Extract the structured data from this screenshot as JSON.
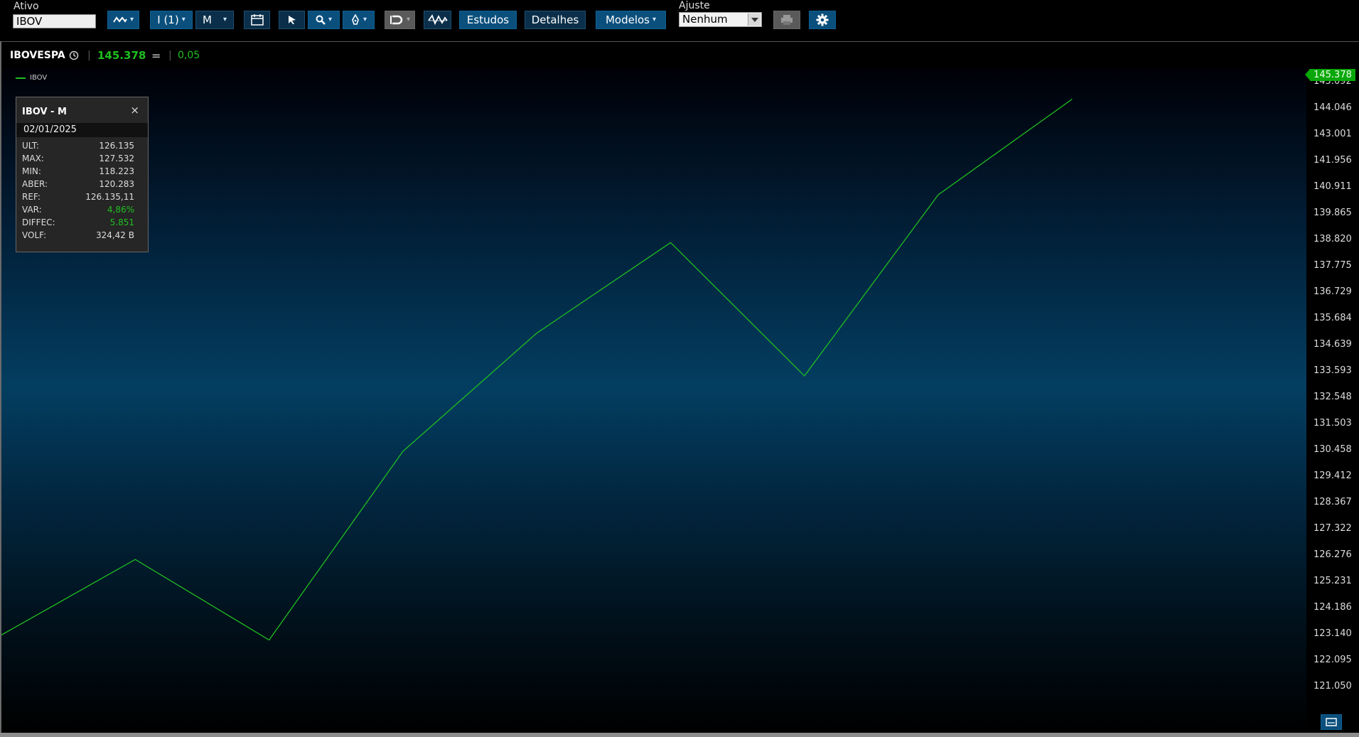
{
  "toolbar": {
    "asset_label": "Ativo",
    "asset_value": "IBOV",
    "interval_label": "I (1)",
    "period_label": "M",
    "studies_label": "Estudos",
    "details_label": "Detalhes",
    "templates_label": "Modelos",
    "adjust_label": "Ajuste",
    "adjust_value": "Nenhum"
  },
  "quote": {
    "symbol": "IBOVESPA",
    "last": "145.378",
    "direction": "=",
    "change": "0,05"
  },
  "legend": {
    "series": "IBOV"
  },
  "info_box": {
    "title": "IBOV - M",
    "close": "×",
    "date": "02/01/2025",
    "rows": [
      {
        "label": "ULT:",
        "value": "126.135"
      },
      {
        "label": "MAX:",
        "value": "127.532"
      },
      {
        "label": "MIN:",
        "value": "118.223"
      },
      {
        "label": "ABER:",
        "value": "120.283"
      },
      {
        "label": "REF:",
        "value": "126.135,11"
      },
      {
        "label": "VAR:",
        "value": "4,86%"
      },
      {
        "label": "DIFFEC:",
        "value": "5.851"
      },
      {
        "label": "VOLF:",
        "value": "324,42 B"
      }
    ]
  },
  "price_tag": "145.378",
  "colors": {
    "line": "#1fbf1f",
    "accent": "#0b4f7c"
  },
  "chart_data": {
    "type": "line",
    "series": [
      {
        "name": "IBOV",
        "values": [
          123.1,
          126.1,
          122.9,
          130.4,
          135.1,
          138.7,
          133.4,
          140.6,
          144.4
        ]
      }
    ],
    "ylim": [
      120.5,
      144.8
    ],
    "y_ticks": [
      "145.092",
      "144.046",
      "143.001",
      "141.956",
      "140.911",
      "139.865",
      "138.820",
      "137.775",
      "136.729",
      "135.684",
      "134.639",
      "133.593",
      "132.548",
      "131.503",
      "130.458",
      "129.412",
      "128.367",
      "127.322",
      "126.276",
      "125.231",
      "124.186",
      "123.140",
      "122.095",
      "121.050"
    ],
    "y_tick_values": [
      145.092,
      144.046,
      143.001,
      141.956,
      140.911,
      139.865,
      138.82,
      137.775,
      136.729,
      135.684,
      134.639,
      133.593,
      132.548,
      131.503,
      130.458,
      129.412,
      128.367,
      127.322,
      126.276,
      125.231,
      124.186,
      123.14,
      122.095,
      121.05
    ]
  }
}
